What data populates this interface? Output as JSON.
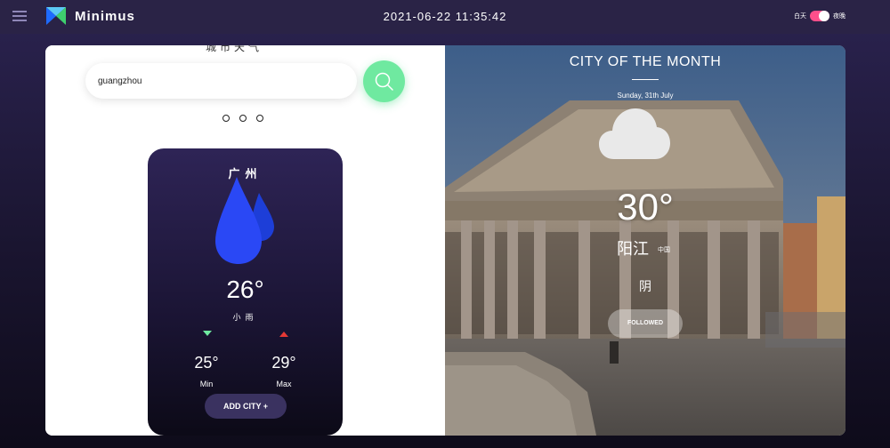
{
  "app": {
    "brand": "Minimus",
    "datetime": "2021-06-22 11:35:42"
  },
  "theme": {
    "day_label": "白天",
    "night_label": "夜晚",
    "accent": "#ff4f8b"
  },
  "search": {
    "value": "guangzhou",
    "button_icon": "search-icon",
    "button_color": "#6fe9a0"
  },
  "left": {
    "clipped_heading": "城市天气"
  },
  "weather_card": {
    "city": "广州",
    "icon": "rain-drops-icon",
    "temp": "26°",
    "description": "小雨",
    "min_temp": "25°",
    "max_temp": "29°",
    "min_label": "Min",
    "max_label": "Max",
    "add_city_label": "ADD CITY +"
  },
  "city_of_month": {
    "title": "CITY OF THE MONTH",
    "date": "Sunday, 31th July",
    "icon": "cloud-icon",
    "temp": "30°",
    "city": "阳江",
    "country": "中国",
    "condition": "阴",
    "followed_label": "FOLLOWED"
  }
}
